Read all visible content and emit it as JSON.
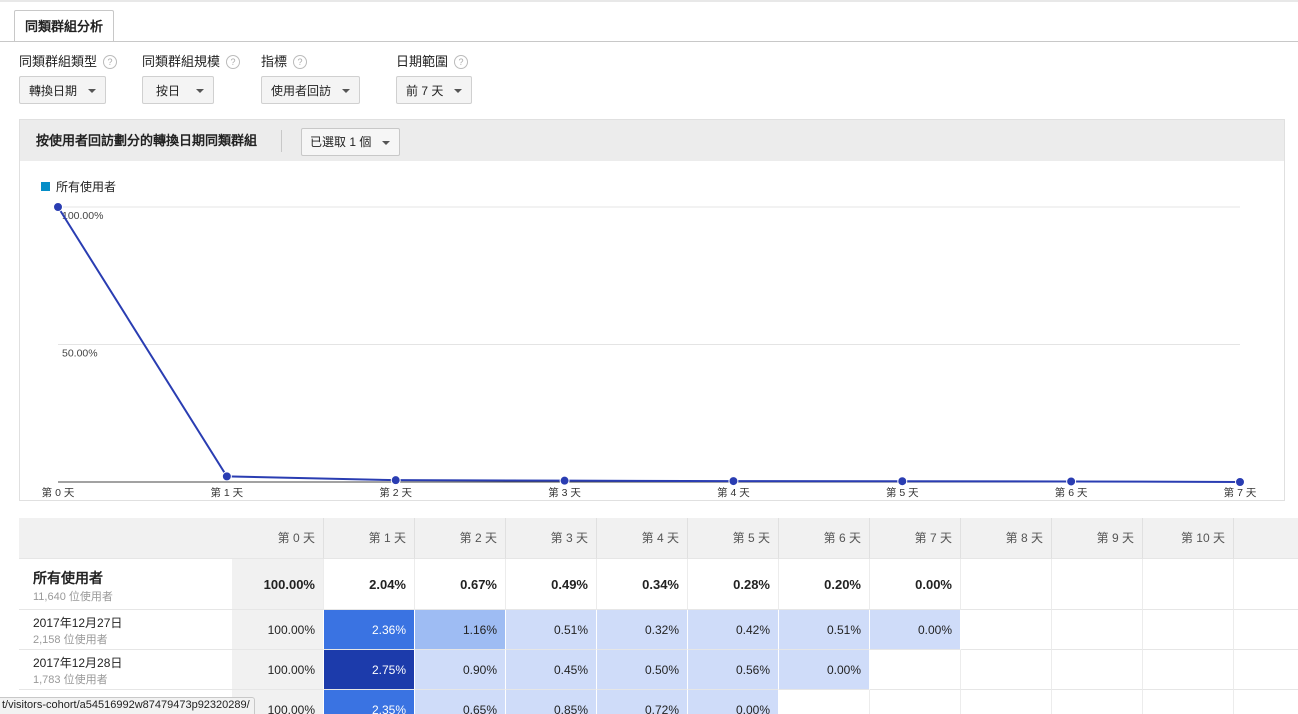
{
  "tab": {
    "label": "同類群組分析"
  },
  "controls": [
    {
      "key": "type",
      "label": "同類群組類型",
      "value": "轉換日期"
    },
    {
      "key": "size",
      "label": "同類群組規模",
      "value": "按日"
    },
    {
      "key": "metric",
      "label": "指標",
      "value": "使用者回訪"
    },
    {
      "key": "range",
      "label": "日期範圍",
      "value": "前 7 天"
    }
  ],
  "panel": {
    "title": "按使用者回訪劃分的轉換日期同類群組",
    "selector": "已選取 1 個"
  },
  "chart_data": {
    "type": "line",
    "x": [
      "第 0 天",
      "第 1 天",
      "第 2 天",
      "第 3 天",
      "第 4 天",
      "第 5 天",
      "第 6 天",
      "第 7 天"
    ],
    "series": [
      {
        "name": "所有使用者",
        "values": [
          100.0,
          2.04,
          0.67,
          0.49,
          0.34,
          0.28,
          0.2,
          0.0
        ],
        "color": "#2a3db2"
      }
    ],
    "y_ticks": [
      "100.00%",
      "50.00%"
    ],
    "ylim": [
      0,
      100
    ],
    "grid": true,
    "legend": "top-left"
  },
  "legend_color": "#058dc7",
  "table": {
    "headers": [
      "第 0 天",
      "第 1 天",
      "第 2 天",
      "第 3 天",
      "第 4 天",
      "第 5 天",
      "第 6 天",
      "第 7 天",
      "第 8 天",
      "第 9 天",
      "第 10 天",
      "第"
    ],
    "summary": {
      "label": "所有使用者",
      "sub": "11,640 位使用者",
      "values": [
        "100.00%",
        "2.04%",
        "0.67%",
        "0.49%",
        "0.34%",
        "0.28%",
        "0.20%",
        "0.00%"
      ]
    },
    "rows": [
      {
        "label": "2017年12月27日",
        "sub": "2,158 位使用者",
        "values": [
          "100.00%",
          "2.36%",
          "1.16%",
          "0.51%",
          "0.32%",
          "0.42%",
          "0.51%",
          "0.00%"
        ]
      },
      {
        "label": "2017年12月28日",
        "sub": "1,783 位使用者",
        "values": [
          "100.00%",
          "2.75%",
          "0.90%",
          "0.45%",
          "0.50%",
          "0.56%",
          "0.00%"
        ]
      },
      {
        "label": "",
        "sub": "",
        "values": [
          "100.00%",
          "2.35%",
          "0.65%",
          "0.85%",
          "0.72%",
          "0.00%"
        ]
      }
    ]
  },
  "status_url": "t/visitors-cohort/a54516992w87479473p92320289/"
}
